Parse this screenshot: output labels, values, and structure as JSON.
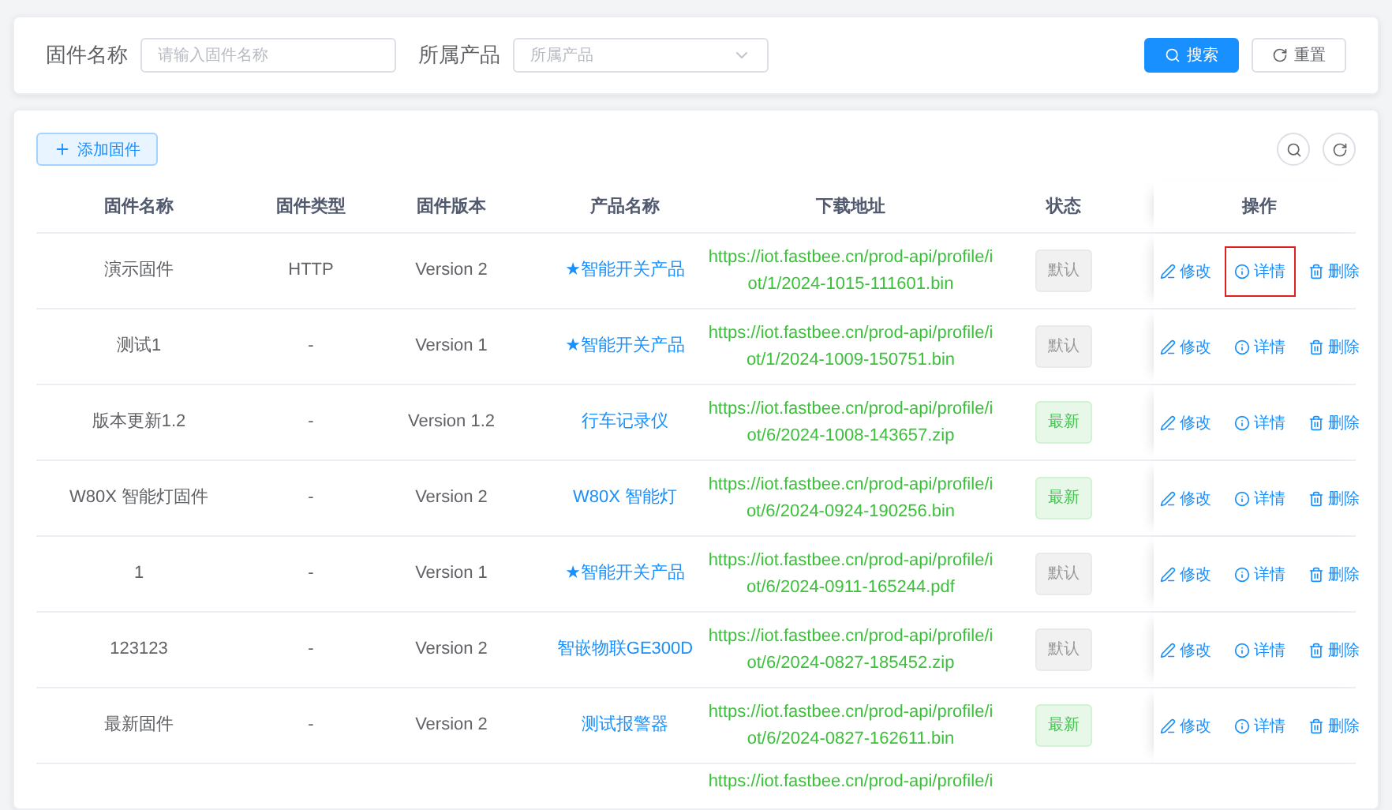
{
  "search_form": {
    "fields": [
      {
        "kind": "input",
        "label": "固件名称",
        "placeholder": "请输入固件名称"
      },
      {
        "kind": "select",
        "label": "所属产品",
        "placeholder": "所属产品"
      }
    ],
    "buttons": [
      {
        "kind": "primary",
        "label": "搜索"
      },
      {
        "kind": "plain",
        "label": "重置"
      }
    ]
  },
  "toolbar": {
    "add_button": "添加固件"
  },
  "table": {
    "columns": [
      "固件名称",
      "固件类型",
      "固件版本",
      "产品名称",
      "下载地址",
      "状态",
      "操作"
    ],
    "rows": [
      {
        "name": "演示固件",
        "type": "HTTP",
        "version": "Version 2",
        "product": "★智能开关产品",
        "url_lines": [
          "https://iot.fastbee.cn/prod-api/profile/i",
          "ot/1/2024-1015-111601.bin"
        ],
        "status": {
          "label": "默认",
          "latest": false
        },
        "actions": [
          {
            "kind": "edit",
            "label": "修改",
            "highlighted": false
          },
          {
            "kind": "detail",
            "label": "详情",
            "highlighted": true
          },
          {
            "kind": "delete",
            "label": "删除",
            "highlighted": false
          }
        ]
      },
      {
        "name": "测试1",
        "type": "-",
        "version": "Version 1",
        "product": "★智能开关产品",
        "url_lines": [
          "https://iot.fastbee.cn/prod-api/profile/i",
          "ot/1/2024-1009-150751.bin"
        ],
        "status": {
          "label": "默认",
          "latest": false
        },
        "actions": [
          {
            "kind": "edit",
            "label": "修改",
            "highlighted": false
          },
          {
            "kind": "detail",
            "label": "详情",
            "highlighted": false
          },
          {
            "kind": "delete",
            "label": "删除",
            "highlighted": false
          }
        ]
      },
      {
        "name": "版本更新1.2",
        "type": "-",
        "version": "Version 1.2",
        "product": "行车记录仪",
        "url_lines": [
          "https://iot.fastbee.cn/prod-api/profile/i",
          "ot/6/2024-1008-143657.zip"
        ],
        "status": {
          "label": "最新",
          "latest": true
        },
        "actions": [
          {
            "kind": "edit",
            "label": "修改",
            "highlighted": false
          },
          {
            "kind": "detail",
            "label": "详情",
            "highlighted": false
          },
          {
            "kind": "delete",
            "label": "删除",
            "highlighted": false
          }
        ]
      },
      {
        "name": "W80X 智能灯固件",
        "type": "-",
        "version": "Version 2",
        "product": "W80X 智能灯",
        "url_lines": [
          "https://iot.fastbee.cn/prod-api/profile/i",
          "ot/6/2024-0924-190256.bin"
        ],
        "status": {
          "label": "最新",
          "latest": true
        },
        "actions": [
          {
            "kind": "edit",
            "label": "修改",
            "highlighted": false
          },
          {
            "kind": "detail",
            "label": "详情",
            "highlighted": false
          },
          {
            "kind": "delete",
            "label": "删除",
            "highlighted": false
          }
        ]
      },
      {
        "name": "1",
        "type": "-",
        "version": "Version 1",
        "product": "★智能开关产品",
        "url_lines": [
          "https://iot.fastbee.cn/prod-api/profile/i",
          "ot/6/2024-0911-165244.pdf"
        ],
        "status": {
          "label": "默认",
          "latest": false
        },
        "actions": [
          {
            "kind": "edit",
            "label": "修改",
            "highlighted": false
          },
          {
            "kind": "detail",
            "label": "详情",
            "highlighted": false
          },
          {
            "kind": "delete",
            "label": "删除",
            "highlighted": false
          }
        ]
      },
      {
        "name": "123123",
        "type": "-",
        "version": "Version 2",
        "product": "智嵌物联GE300D",
        "url_lines": [
          "https://iot.fastbee.cn/prod-api/profile/i",
          "ot/6/2024-0827-185452.zip"
        ],
        "status": {
          "label": "默认",
          "latest": false
        },
        "actions": [
          {
            "kind": "edit",
            "label": "修改",
            "highlighted": false
          },
          {
            "kind": "detail",
            "label": "详情",
            "highlighted": false
          },
          {
            "kind": "delete",
            "label": "删除",
            "highlighted": false
          }
        ]
      },
      {
        "name": "最新固件",
        "type": "-",
        "version": "Version 2",
        "product": "测试报警器",
        "url_lines": [
          "https://iot.fastbee.cn/prod-api/profile/i",
          "ot/6/2024-0827-162611.bin"
        ],
        "status": {
          "label": "最新",
          "latest": true
        },
        "actions": [
          {
            "kind": "edit",
            "label": "修改",
            "highlighted": false
          },
          {
            "kind": "detail",
            "label": "详情",
            "highlighted": false
          },
          {
            "kind": "delete",
            "label": "删除",
            "highlighted": false
          }
        ]
      },
      {
        "url_lines": [
          "https://iot.fastbee.cn/prod-api/profile/i"
        ]
      }
    ]
  }
}
